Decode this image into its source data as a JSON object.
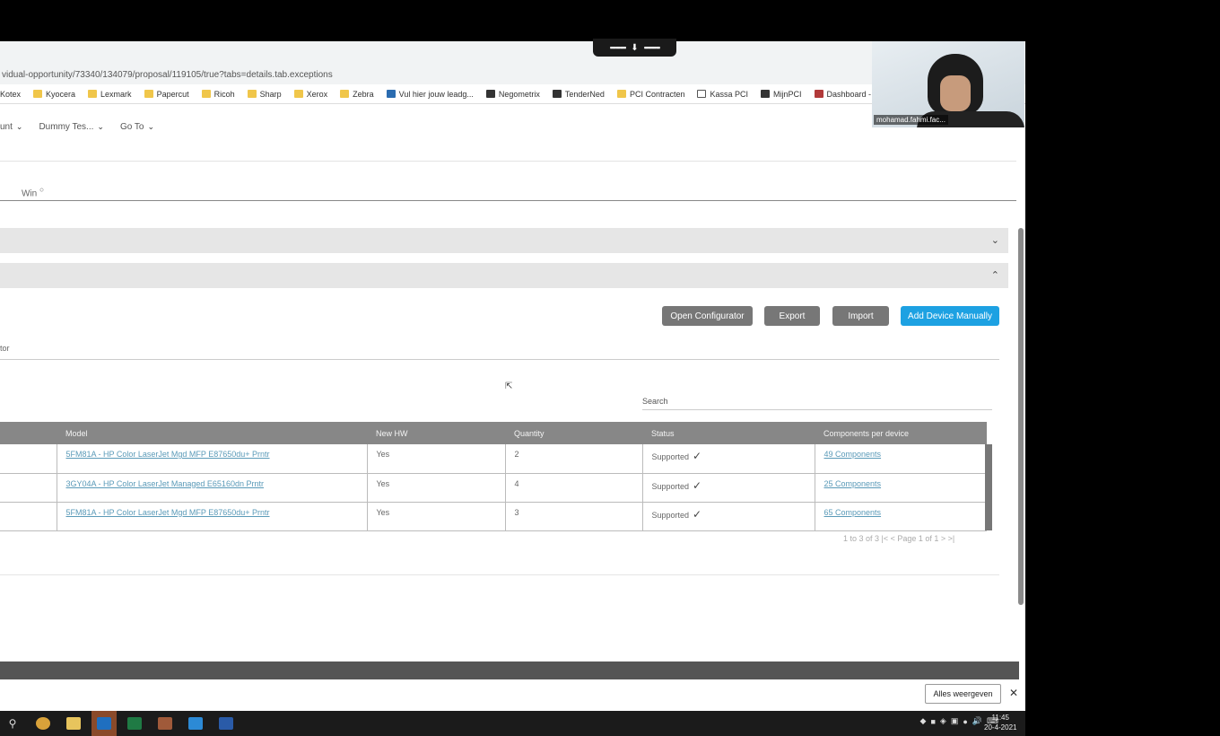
{
  "browser": {
    "url": "vidual-opportunity/73340/134079/proposal/119105/true?tabs=details.tab.exceptions",
    "bookmarks": [
      "Kotex",
      "Kyocera",
      "Lexmark",
      "Papercut",
      "Ricoh",
      "Sharp",
      "Xerox",
      "Zebra",
      "Vul hier jouw leadg...",
      "Negometrix",
      "TenderNed",
      "PCI Contracten",
      "Kassa PCI",
      "MijnPCI",
      "Dashboard - Sowor..."
    ]
  },
  "share_bar": {
    "dots_left": "▪▪▪▪▪▪▪▪",
    "arrow": "⬇",
    "dots_right": "▪▪▪▪▪▪▪▪"
  },
  "topnav": {
    "item1": "unt",
    "item2": "Dummy Tes...",
    "item3": "Go To"
  },
  "stage": {
    "win_label": "Win",
    "win_marker": "○"
  },
  "toolbar": {
    "open_configurator": "Open Configurator",
    "export": "Export",
    "import": "Import",
    "add_device": "Add Device Manually"
  },
  "section": {
    "sub_label": "tor",
    "search_label": "Search"
  },
  "table": {
    "headers": [
      "",
      "Model",
      "New HW",
      "Quantity",
      "Status",
      "Components per device"
    ],
    "rows": [
      {
        "model": "5FM81A - HP Color LaserJet Mgd MFP E87650du+ Prntr",
        "new_hw": "Yes",
        "quantity": "2",
        "status": "Supported",
        "components": "49 Components"
      },
      {
        "model": "3GY04A - HP Color LaserJet Managed E65160dn Prntr",
        "new_hw": "Yes",
        "quantity": "4",
        "status": "Supported",
        "components": "25 Components"
      },
      {
        "model": "5FM81A - HP Color LaserJet Mgd MFP E87650du+ Prntr",
        "new_hw": "Yes",
        "quantity": "3",
        "status": "Supported",
        "components": "65 Components"
      }
    ],
    "pager": "1 to 3 of 3    |<  <  Page 1 of 1  >  >|"
  },
  "video": {
    "name": "mohamad.fahmi.fac..."
  },
  "notification": {
    "show_all": "Alles weergeven",
    "close": "✕"
  },
  "taskbar": {
    "time": "11:45",
    "date": "20-4-2021"
  },
  "colors": {
    "primary_button": "#1da1e2",
    "secondary_button": "#777777",
    "table_header": "#878787"
  }
}
